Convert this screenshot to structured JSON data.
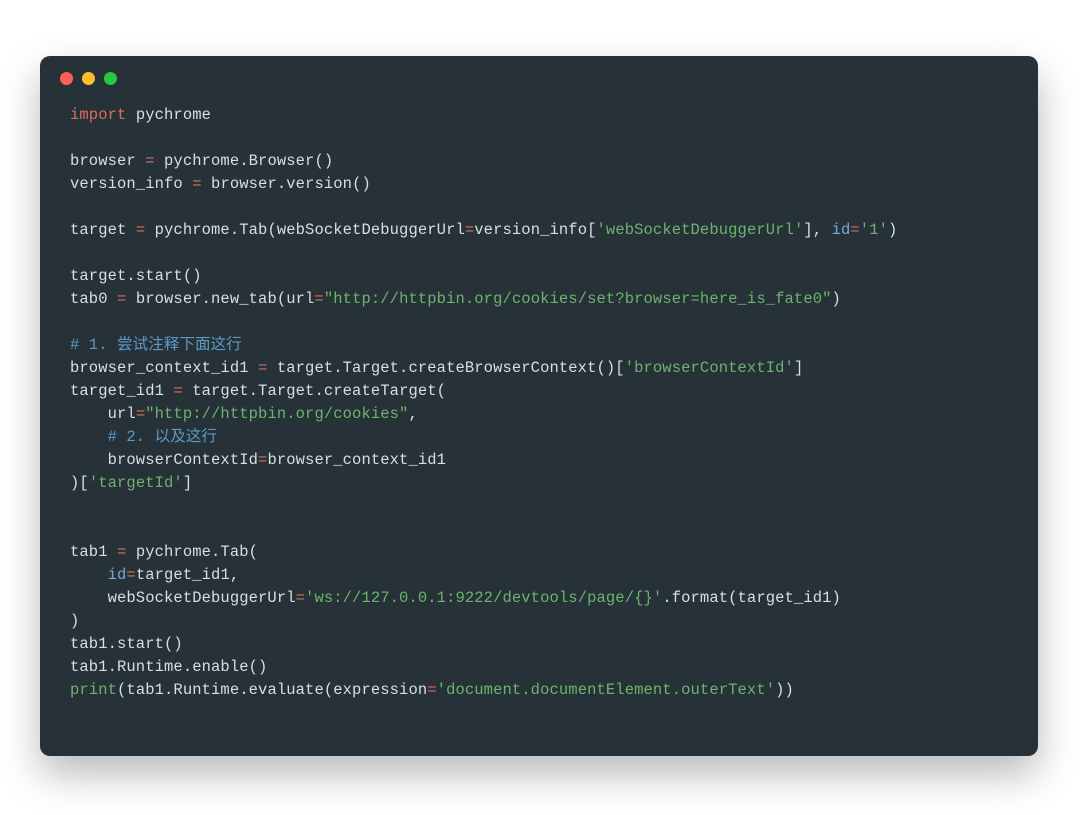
{
  "colors": {
    "window_bg": "#263238",
    "text": "#d7dee4",
    "keyword": "#e06c60",
    "operator": "#e06c60",
    "string": "#6db26f",
    "builtin": "#6db26f",
    "comment": "#5d99c6",
    "identifier": "#7aa6da",
    "traffic_red": "#ff5f56",
    "traffic_yellow": "#ffbd2e",
    "traffic_green": "#27c93f"
  },
  "traffic_lights": [
    "close",
    "minimize",
    "zoom"
  ],
  "code": {
    "l01": {
      "kw": "import",
      "mod": " pychrome"
    },
    "l02": "",
    "l03": {
      "a": "browser ",
      "op": "=",
      "b": " pychrome.Browser()"
    },
    "l04": {
      "a": "version_info ",
      "op": "=",
      "b": " browser.version()"
    },
    "l05": "",
    "l06": {
      "a": "target ",
      "op1": "=",
      "b": " pychrome.Tab(webSocketDebuggerUrl",
      "op2": "=",
      "c": "version_info[",
      "s1": "'webSocketDebuggerUrl'",
      "d": "], ",
      "id": "id",
      "op3": "=",
      "s2": "'1'",
      "e": ")"
    },
    "l07": "",
    "l08": "target.start()",
    "l09": {
      "a": "tab0 ",
      "op1": "=",
      "b": " browser.new_tab(url",
      "op2": "=",
      "s": "\"http://httpbin.org/cookies/set?browser=here_is_fate0\"",
      "c": ")"
    },
    "l10": "",
    "l11": "# 1. 尝试注释下面这行",
    "l12": {
      "a": "browser_context_id1 ",
      "op": "=",
      "b": " target.Target.createBrowserContext()[",
      "s": "'browserContextId'",
      "c": "]"
    },
    "l13": {
      "a": "target_id1 ",
      "op": "=",
      "b": " target.Target.createTarget("
    },
    "l14": {
      "a": "    url",
      "op": "=",
      "s": "\"http://httpbin.org/cookies\"",
      "b": ","
    },
    "l15": "    # 2. 以及这行",
    "l16": {
      "a": "    browserContextId",
      "op": "=",
      "b": "browser_context_id1"
    },
    "l17": {
      "a": ")[",
      "s": "'targetId'",
      "b": "]"
    },
    "l18": "",
    "l19": "",
    "l20": {
      "a": "tab1 ",
      "op": "=",
      "b": " pychrome.Tab("
    },
    "l21": {
      "a": "    ",
      "id": "id",
      "op": "=",
      "b": "target_id1,"
    },
    "l22": {
      "a": "    webSocketDebuggerUrl",
      "op": "=",
      "s": "'ws://127.0.0.1:9222/devtools/page/{}'",
      "b": ".format(target_id1)"
    },
    "l23": ")",
    "l24": "tab1.start()",
    "l25": "tab1.Runtime.enable()",
    "l26": {
      "fn": "print",
      "a": "(tab1.Runtime.evaluate(expression",
      "op": "=",
      "s": "'document.documentElement.outerText'",
      "b": "))"
    }
  }
}
